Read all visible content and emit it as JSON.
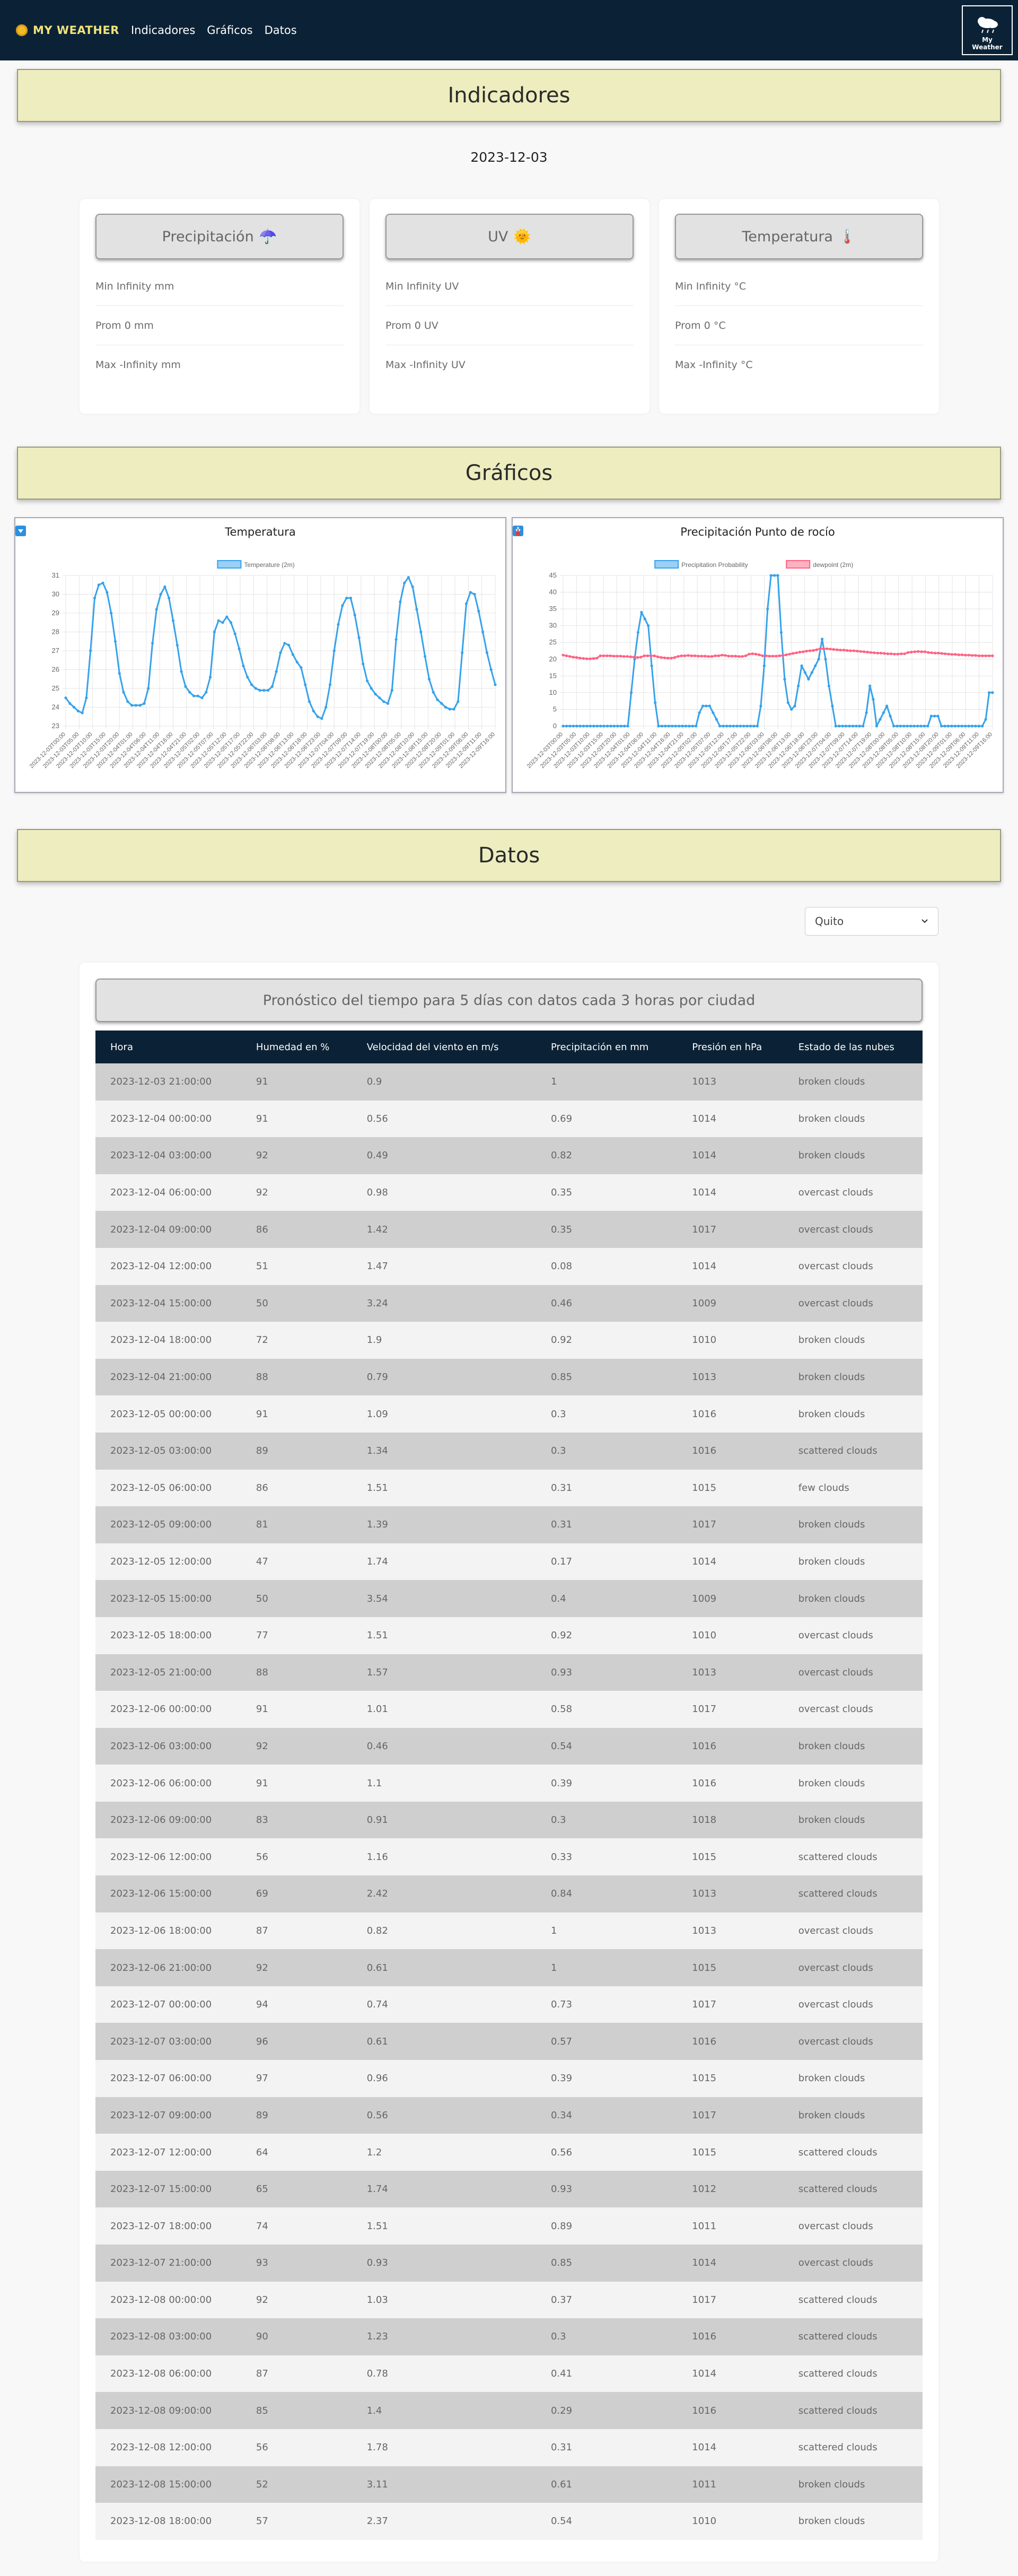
{
  "nav": {
    "brand": "MY WEATHER",
    "links": [
      "Indicadores",
      "Gráficos",
      "Datos"
    ],
    "logo_line1": "My",
    "logo_line2": "Weather"
  },
  "indicadores": {
    "title": "Indicadores",
    "date": "2023-12-03",
    "cards": [
      {
        "title": "Precipitación",
        "icon": "umbrella-icon",
        "emoji": "☂️",
        "min": "Min Infinity mm",
        "avg": "Prom 0 mm",
        "max": "Max -Infinity mm"
      },
      {
        "title": "UV",
        "icon": "sun-icon",
        "emoji": "🌞",
        "min": "Min Infinity UV",
        "avg": "Prom 0 UV",
        "max": "Max -Infinity UV"
      },
      {
        "title": "Temperatura",
        "icon": "thermometer-icon",
        "emoji": "🌡️",
        "min": "Min Infinity °C",
        "avg": "Prom 0 °C",
        "max": "Max -Infinity °C"
      }
    ]
  },
  "graficos": {
    "title": "Gráficos"
  },
  "chart_data": [
    {
      "type": "line",
      "title": "Temperatura",
      "title_icon": "arrow-down-box-icon",
      "series": [
        {
          "name": "Temperature (2m)",
          "color": "#36a2eb",
          "values": [
            24.5,
            24.2,
            24.0,
            23.8,
            23.7,
            24.5,
            27.0,
            29.8,
            30.5,
            30.6,
            30.1,
            29.0,
            27.5,
            25.8,
            24.8,
            24.3,
            24.1,
            24.1,
            24.1,
            24.2,
            25.0,
            27.4,
            29.2,
            30.0,
            30.4,
            29.8,
            28.6,
            27.3,
            25.9,
            25.1,
            24.8,
            24.6,
            24.6,
            24.5,
            24.8,
            25.6,
            28.0,
            28.6,
            28.5,
            28.8,
            28.5,
            27.9,
            27.1,
            26.2,
            25.6,
            25.2,
            25.0,
            24.9,
            24.9,
            24.9,
            25.1,
            25.9,
            26.9,
            27.4,
            27.3,
            26.8,
            26.4,
            26.1,
            25.2,
            24.3,
            23.8,
            23.5,
            23.4,
            24.0,
            25.2,
            27.0,
            28.4,
            29.4,
            29.8,
            29.8,
            28.9,
            27.7,
            26.3,
            25.4,
            25.0,
            24.7,
            24.5,
            24.3,
            24.2,
            24.9,
            27.6,
            29.6,
            30.6,
            30.9,
            30.4,
            29.2,
            28.0,
            26.7,
            25.5,
            24.8,
            24.4,
            24.2,
            24.0,
            23.9,
            23.9,
            24.3,
            26.9,
            29.5,
            30.1,
            30.0,
            29.1,
            28.0,
            26.9,
            26.0,
            25.2
          ]
        }
      ],
      "x_tick_labels": [
        "2023-12-03T00:00",
        "2023-12-03T05:00",
        "2023-12-03T10:00",
        "2023-12-03T15:00",
        "2023-12-03T20:00",
        "2023-12-04T01:00",
        "2023-12-04T06:00",
        "2023-12-04T11:00",
        "2023-12-04T16:00",
        "2023-12-04T21:00",
        "2023-12-05T02:00",
        "2023-12-05T07:00",
        "2023-12-05T12:00",
        "2023-12-05T17:00",
        "2023-12-05T22:00",
        "2023-12-06T03:00",
        "2023-12-06T08:00",
        "2023-12-06T13:00",
        "2023-12-06T18:00",
        "2023-12-06T23:00",
        "2023-12-07T04:00",
        "2023-12-07T09:00",
        "2023-12-07T14:00",
        "2023-12-07T19:00",
        "2023-12-08T00:00",
        "2023-12-08T05:00",
        "2023-12-08T10:00",
        "2023-12-08T15:00",
        "2023-12-08T20:00",
        "2023-12-09T01:00",
        "2023-12-09T06:00",
        "2023-12-09T11:00",
        "2023-12-09T16:00"
      ],
      "y_ticks": [
        23,
        24,
        25,
        26,
        27,
        28,
        29,
        30,
        31
      ],
      "ylim": [
        23,
        31
      ],
      "grid": true,
      "legend": "top"
    },
    {
      "type": "line",
      "title": "Precipitación",
      "title2": "Punto de rocío",
      "title_icon": "arrow-down-box-icon",
      "title2_icon": "thermometer-icon",
      "series": [
        {
          "name": "Precipitation Probability",
          "color": "#36a2eb",
          "values": [
            0,
            0,
            0,
            0,
            0,
            0,
            0,
            0,
            0,
            0,
            0,
            0,
            0,
            0,
            0,
            0,
            0,
            0,
            0,
            0,
            10,
            20,
            28,
            34,
            32,
            30,
            18,
            7,
            0,
            0,
            0,
            0,
            0,
            0,
            0,
            0,
            0,
            0,
            0,
            0,
            4,
            6,
            6,
            6,
            4,
            2,
            0,
            0,
            0,
            0,
            0,
            0,
            0,
            0,
            0,
            0,
            0,
            0,
            6,
            18,
            35,
            45,
            45,
            45,
            28,
            14,
            7,
            5,
            6,
            12,
            18,
            16,
            14,
            16,
            18,
            20,
            26,
            20,
            12,
            6,
            0,
            0,
            0,
            0,
            0,
            0,
            0,
            0,
            0,
            4,
            12,
            8,
            0,
            2,
            4,
            6,
            3,
            0,
            0,
            0,
            0,
            0,
            0,
            0,
            0,
            0,
            0,
            0,
            3,
            3,
            3,
            0,
            0,
            0,
            0,
            0,
            0,
            0,
            0,
            0,
            0,
            0,
            0,
            0,
            2,
            10,
            10
          ]
        },
        {
          "name": "dewpoint (2m)",
          "color": "#ff6384",
          "values": [
            21.2,
            21.0,
            20.8,
            20.6,
            20.5,
            20.3,
            20.2,
            20.1,
            20.1,
            20.2,
            20.3,
            21.0,
            21.0,
            21.0,
            21.0,
            20.9,
            20.9,
            20.9,
            20.8,
            20.8,
            20.7,
            20.6,
            20.5,
            20.6,
            21.0,
            21.0,
            21.0,
            21.0,
            20.7,
            20.5,
            20.4,
            20.3,
            20.3,
            20.5,
            20.8,
            21.0,
            21.0,
            21.1,
            21.0,
            21.0,
            20.9,
            20.9,
            20.9,
            20.8,
            20.8,
            21.0,
            21.0,
            21.2,
            21.1,
            20.9,
            20.9,
            20.9,
            20.8,
            20.8,
            21.0,
            21.5,
            21.6,
            21.5,
            21.3,
            21.0,
            21.0,
            20.9,
            20.9,
            20.9,
            21.0,
            21.1,
            21.3,
            21.5,
            21.7,
            21.9,
            22.1,
            22.2,
            22.4,
            22.5,
            22.6,
            22.8,
            23.1,
            23.1,
            23.1,
            23.0,
            22.9,
            22.8,
            22.7,
            22.7,
            22.6,
            22.5,
            22.5,
            22.4,
            22.3,
            22.2,
            22.1,
            22.0,
            21.9,
            21.8,
            21.8,
            21.7,
            21.6,
            21.6,
            21.5,
            21.5,
            21.6,
            21.6,
            22.0,
            22.1,
            22.2,
            22.3,
            22.2,
            22.2,
            22.0,
            21.9,
            21.8,
            21.8,
            21.7,
            21.6,
            21.5,
            21.4,
            21.4,
            21.3,
            21.3,
            21.2,
            21.2,
            21.1,
            21.1,
            21.0,
            21.0,
            21.0,
            21.0,
            21.0
          ]
        }
      ],
      "x_tick_labels": [
        "2023-12-03T00:00",
        "2023-12-03T05:00",
        "2023-12-03T10:00",
        "2023-12-03T15:00",
        "2023-12-03T20:00",
        "2023-12-04T01:00",
        "2023-12-04T06:00",
        "2023-12-04T11:00",
        "2023-12-04T16:00",
        "2023-12-04T21:00",
        "2023-12-05T02:00",
        "2023-12-05T07:00",
        "2023-12-05T12:00",
        "2023-12-05T17:00",
        "2023-12-05T22:00",
        "2023-12-06T03:00",
        "2023-12-06T08:00",
        "2023-12-06T13:00",
        "2023-12-06T18:00",
        "2023-12-06T23:00",
        "2023-12-07T04:00",
        "2023-12-07T09:00",
        "2023-12-07T14:00",
        "2023-12-07T19:00",
        "2023-12-08T00:00",
        "2023-12-08T05:00",
        "2023-12-08T10:00",
        "2023-12-08T15:00",
        "2023-12-08T20:00",
        "2023-12-09T01:00",
        "2023-12-09T06:00",
        "2023-12-09T11:00",
        "2023-12-09T16:00"
      ],
      "y_ticks": [
        0,
        5,
        10,
        15,
        20,
        25,
        30,
        35,
        40,
        45
      ],
      "ylim": [
        0,
        45
      ],
      "grid": true,
      "legend": "top"
    }
  ],
  "datos": {
    "title": "Datos",
    "city_select": "Quito",
    "table_title": "Pronóstico del tiempo para 5 días con datos cada 3 horas por ciudad",
    "columns": [
      "Hora",
      "Humedad en %",
      "Velocidad del viento en m/s",
      "Precipitación en mm",
      "Presión en hPa",
      "Estado de las nubes"
    ],
    "rows": [
      [
        "2023-12-03 21:00:00",
        "91",
        "0.9",
        "1",
        "1013",
        "broken clouds"
      ],
      [
        "2023-12-04 00:00:00",
        "91",
        "0.56",
        "0.69",
        "1014",
        "broken clouds"
      ],
      [
        "2023-12-04 03:00:00",
        "92",
        "0.49",
        "0.82",
        "1014",
        "broken clouds"
      ],
      [
        "2023-12-04 06:00:00",
        "92",
        "0.98",
        "0.35",
        "1014",
        "overcast clouds"
      ],
      [
        "2023-12-04 09:00:00",
        "86",
        "1.42",
        "0.35",
        "1017",
        "overcast clouds"
      ],
      [
        "2023-12-04 12:00:00",
        "51",
        "1.47",
        "0.08",
        "1014",
        "overcast clouds"
      ],
      [
        "2023-12-04 15:00:00",
        "50",
        "3.24",
        "0.46",
        "1009",
        "overcast clouds"
      ],
      [
        "2023-12-04 18:00:00",
        "72",
        "1.9",
        "0.92",
        "1010",
        "broken clouds"
      ],
      [
        "2023-12-04 21:00:00",
        "88",
        "0.79",
        "0.85",
        "1013",
        "broken clouds"
      ],
      [
        "2023-12-05 00:00:00",
        "91",
        "1.09",
        "0.3",
        "1016",
        "broken clouds"
      ],
      [
        "2023-12-05 03:00:00",
        "89",
        "1.34",
        "0.3",
        "1016",
        "scattered clouds"
      ],
      [
        "2023-12-05 06:00:00",
        "86",
        "1.51",
        "0.31",
        "1015",
        "few clouds"
      ],
      [
        "2023-12-05 09:00:00",
        "81",
        "1.39",
        "0.31",
        "1017",
        "broken clouds"
      ],
      [
        "2023-12-05 12:00:00",
        "47",
        "1.74",
        "0.17",
        "1014",
        "broken clouds"
      ],
      [
        "2023-12-05 15:00:00",
        "50",
        "3.54",
        "0.4",
        "1009",
        "broken clouds"
      ],
      [
        "2023-12-05 18:00:00",
        "77",
        "1.51",
        "0.92",
        "1010",
        "overcast clouds"
      ],
      [
        "2023-12-05 21:00:00",
        "88",
        "1.57",
        "0.93",
        "1013",
        "overcast clouds"
      ],
      [
        "2023-12-06 00:00:00",
        "91",
        "1.01",
        "0.58",
        "1017",
        "overcast clouds"
      ],
      [
        "2023-12-06 03:00:00",
        "92",
        "0.46",
        "0.54",
        "1016",
        "broken clouds"
      ],
      [
        "2023-12-06 06:00:00",
        "91",
        "1.1",
        "0.39",
        "1016",
        "broken clouds"
      ],
      [
        "2023-12-06 09:00:00",
        "83",
        "0.91",
        "0.3",
        "1018",
        "broken clouds"
      ],
      [
        "2023-12-06 12:00:00",
        "56",
        "1.16",
        "0.33",
        "1015",
        "scattered clouds"
      ],
      [
        "2023-12-06 15:00:00",
        "69",
        "2.42",
        "0.84",
        "1013",
        "scattered clouds"
      ],
      [
        "2023-12-06 18:00:00",
        "87",
        "0.82",
        "1",
        "1013",
        "overcast clouds"
      ],
      [
        "2023-12-06 21:00:00",
        "92",
        "0.61",
        "1",
        "1015",
        "overcast clouds"
      ],
      [
        "2023-12-07 00:00:00",
        "94",
        "0.74",
        "0.73",
        "1017",
        "overcast clouds"
      ],
      [
        "2023-12-07 03:00:00",
        "96",
        "0.61",
        "0.57",
        "1016",
        "overcast clouds"
      ],
      [
        "2023-12-07 06:00:00",
        "97",
        "0.96",
        "0.39",
        "1015",
        "broken clouds"
      ],
      [
        "2023-12-07 09:00:00",
        "89",
        "0.56",
        "0.34",
        "1017",
        "broken clouds"
      ],
      [
        "2023-12-07 12:00:00",
        "64",
        "1.2",
        "0.56",
        "1015",
        "scattered clouds"
      ],
      [
        "2023-12-07 15:00:00",
        "65",
        "1.74",
        "0.93",
        "1012",
        "scattered clouds"
      ],
      [
        "2023-12-07 18:00:00",
        "74",
        "1.51",
        "0.89",
        "1011",
        "overcast clouds"
      ],
      [
        "2023-12-07 21:00:00",
        "93",
        "0.93",
        "0.85",
        "1014",
        "overcast clouds"
      ],
      [
        "2023-12-08 00:00:00",
        "92",
        "1.03",
        "0.37",
        "1017",
        "scattered clouds"
      ],
      [
        "2023-12-08 03:00:00",
        "90",
        "1.23",
        "0.3",
        "1016",
        "scattered clouds"
      ],
      [
        "2023-12-08 06:00:00",
        "87",
        "0.78",
        "0.41",
        "1014",
        "scattered clouds"
      ],
      [
        "2023-12-08 09:00:00",
        "85",
        "1.4",
        "0.29",
        "1016",
        "scattered clouds"
      ],
      [
        "2023-12-08 12:00:00",
        "56",
        "1.78",
        "0.31",
        "1014",
        "scattered clouds"
      ],
      [
        "2023-12-08 15:00:00",
        "52",
        "3.11",
        "0.61",
        "1011",
        "broken clouds"
      ],
      [
        "2023-12-08 18:00:00",
        "57",
        "2.37",
        "0.54",
        "1010",
        "broken clouds"
      ]
    ]
  }
}
